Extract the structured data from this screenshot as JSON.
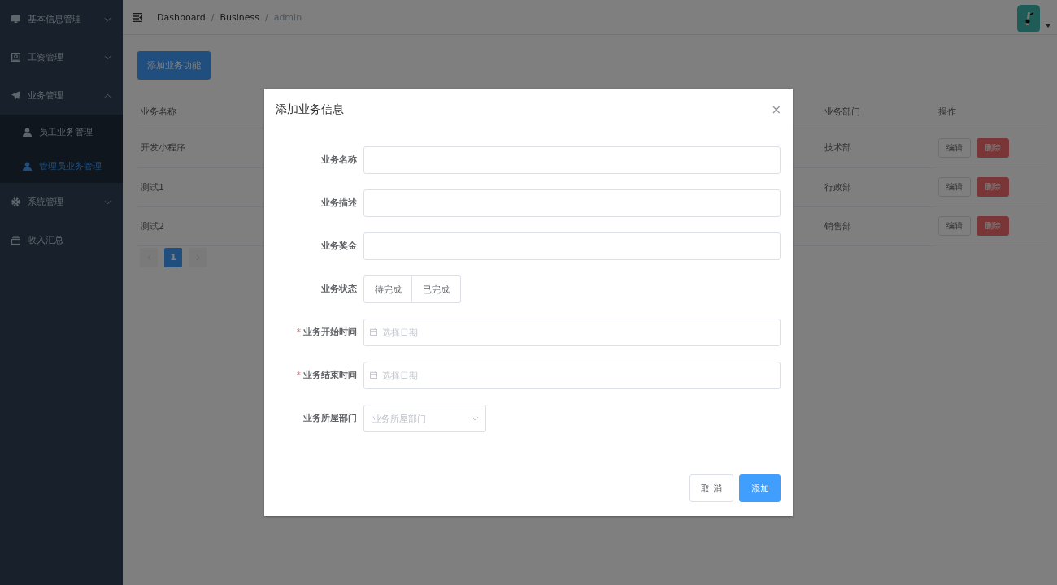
{
  "sidebar": {
    "items": [
      {
        "label": "基本信息管理",
        "expanded": false
      },
      {
        "label": "工资管理",
        "expanded": false
      },
      {
        "label": "业务管理",
        "expanded": true,
        "children": [
          {
            "label": "员工业务管理",
            "selected": false
          },
          {
            "label": "管理员业务管理",
            "selected": true
          }
        ]
      },
      {
        "label": "系统管理",
        "expanded": false
      },
      {
        "label": "收入汇总"
      }
    ]
  },
  "breadcrumb": [
    {
      "label": "Dashboard",
      "current": false
    },
    {
      "label": "Business",
      "current": false
    },
    {
      "label": "admin",
      "current": true
    }
  ],
  "breadcrumb_separator": "/",
  "add_button": "添加业务功能",
  "table": {
    "columns": [
      "业务名称",
      "业务部门",
      "操作"
    ],
    "rows": [
      {
        "cells": [
          "开发小程序",
          "技术部"
        ],
        "actions": [
          "编辑",
          "删除"
        ]
      },
      {
        "cells": [
          "测试1",
          "行政部"
        ],
        "actions": [
          "编辑",
          "删除"
        ]
      },
      {
        "cells": [
          "测试2",
          "销售部"
        ],
        "actions": [
          "编辑",
          "删除"
        ]
      }
    ]
  },
  "pagination": {
    "pages": [
      {
        "label": "1",
        "selected": true
      }
    ]
  },
  "dialog": {
    "title": "添加业务信息",
    "close": "×",
    "required_mark": "*",
    "fields": [
      {
        "kind": "text",
        "label": "业务名称",
        "required": false
      },
      {
        "kind": "text",
        "label": "业务描述",
        "required": false
      },
      {
        "kind": "text",
        "label": "业务奖金",
        "required": false
      },
      {
        "kind": "segmented",
        "label": "业务状态",
        "required": false,
        "options": [
          {
            "label": "待完成",
            "selected": false
          },
          {
            "label": "已完成",
            "selected": false
          }
        ]
      },
      {
        "kind": "date",
        "label": "业务开始时间",
        "required": true,
        "placeholder": "选择日期"
      },
      {
        "kind": "date",
        "label": "业务结束时间",
        "required": true,
        "placeholder": "选择日期"
      },
      {
        "kind": "select",
        "label": "业务所屋部门",
        "required": false,
        "placeholder": "业务所屋部门"
      }
    ],
    "buttons": [
      {
        "label": "取 消",
        "kind": "default"
      },
      {
        "label": "添加",
        "kind": "primary"
      }
    ]
  }
}
